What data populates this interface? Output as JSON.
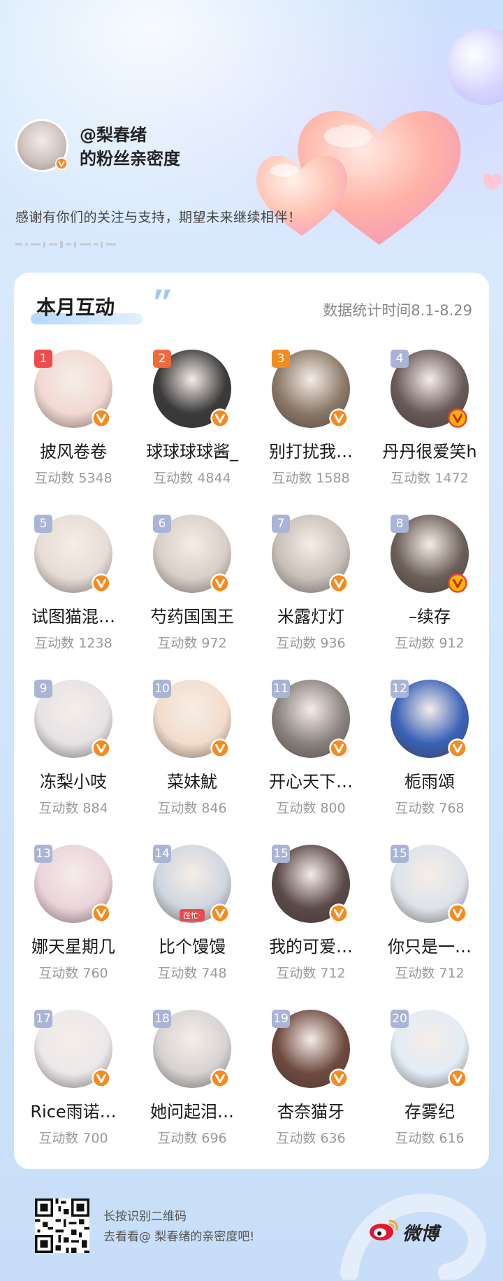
{
  "header": {
    "handle": "@梨春绪",
    "subtitle": "的粉丝亲密度",
    "thanks": "感谢有你们的关注与支持，期望未来继续相伴！"
  },
  "card": {
    "title": "本月互动",
    "stat_time": "数据统计时间8.1-8.29"
  },
  "fans": [
    {
      "rank": "1",
      "name": "披风卷卷",
      "count": "互动数 5348",
      "tone": "#f2d9d2"
    },
    {
      "rank": "2",
      "name": "球球球球酱_",
      "count": "互动数 4844",
      "tone": "#3a3a3a"
    },
    {
      "rank": "3",
      "name": "别打扰我…",
      "count": "互动数 1588",
      "tone": "#8a7868"
    },
    {
      "rank": "4",
      "name": "丹丹很爱笑h",
      "count": "互动数 1472",
      "tone": "#6a5a5a"
    },
    {
      "rank": "5",
      "name": "试图猫混…",
      "count": "互动数 1238",
      "tone": "#e8ddd6"
    },
    {
      "rank": "6",
      "name": "芍药国国王",
      "count": "互动数 972",
      "tone": "#d9cfc8"
    },
    {
      "rank": "7",
      "name": "米露灯灯",
      "count": "互动数 936",
      "tone": "#c8bfb8"
    },
    {
      "rank": "8",
      "name": "–续存",
      "count": "互动数 912",
      "tone": "#6b5f58"
    },
    {
      "rank": "9",
      "name": "冻梨小吱",
      "count": "互动数 884",
      "tone": "#e6e3e6"
    },
    {
      "rank": "10",
      "name": "菜妹魷",
      "count": "互动数 846",
      "tone": "#f3ddcc"
    },
    {
      "rank": "11",
      "name": "开心天下…",
      "count": "互动数 800",
      "tone": "#8a827e"
    },
    {
      "rank": "12",
      "name": "栀雨頌",
      "count": "互动数 768",
      "tone": "#3a62b8"
    },
    {
      "rank": "13",
      "name": "娜天星期几",
      "count": "互动数 760",
      "tone": "#ead4da"
    },
    {
      "rank": "14",
      "name": "比个馒馒",
      "count": "互动数 748",
      "tone": "#cfd6e0"
    },
    {
      "rank": "15",
      "name": "我的可爱…",
      "count": "互动数 712",
      "tone": "#5a4a48"
    },
    {
      "rank": "15",
      "name": "你只是一…",
      "count": "互动数 712",
      "tone": "#dde3ea"
    },
    {
      "rank": "17",
      "name": "Rice雨诺…",
      "count": "互动数 700",
      "tone": "#ece8ea"
    },
    {
      "rank": "18",
      "name": "她问起泪…",
      "count": "互动数 696",
      "tone": "#d7d3d3"
    },
    {
      "rank": "19",
      "name": "杏奈猫牙",
      "count": "互动数 636",
      "tone": "#6e4a40"
    },
    {
      "rank": "20",
      "name": "存雾纪",
      "count": "互动数 616",
      "tone": "#e2ecf5"
    }
  ],
  "busy_tag": "在忙·",
  "footer": {
    "line1": "长按识别二维码",
    "line2": "去看看@ 梨春绪的亲密度吧!",
    "brand": "微博"
  },
  "colors": {
    "rank1": "#f04a4a",
    "rank2": "#f26a3a",
    "rank3": "#f58b1e",
    "rank_other": "#aab4d6",
    "vbadge": "#f78a1d",
    "vbadge_gold": "#f7b500"
  }
}
